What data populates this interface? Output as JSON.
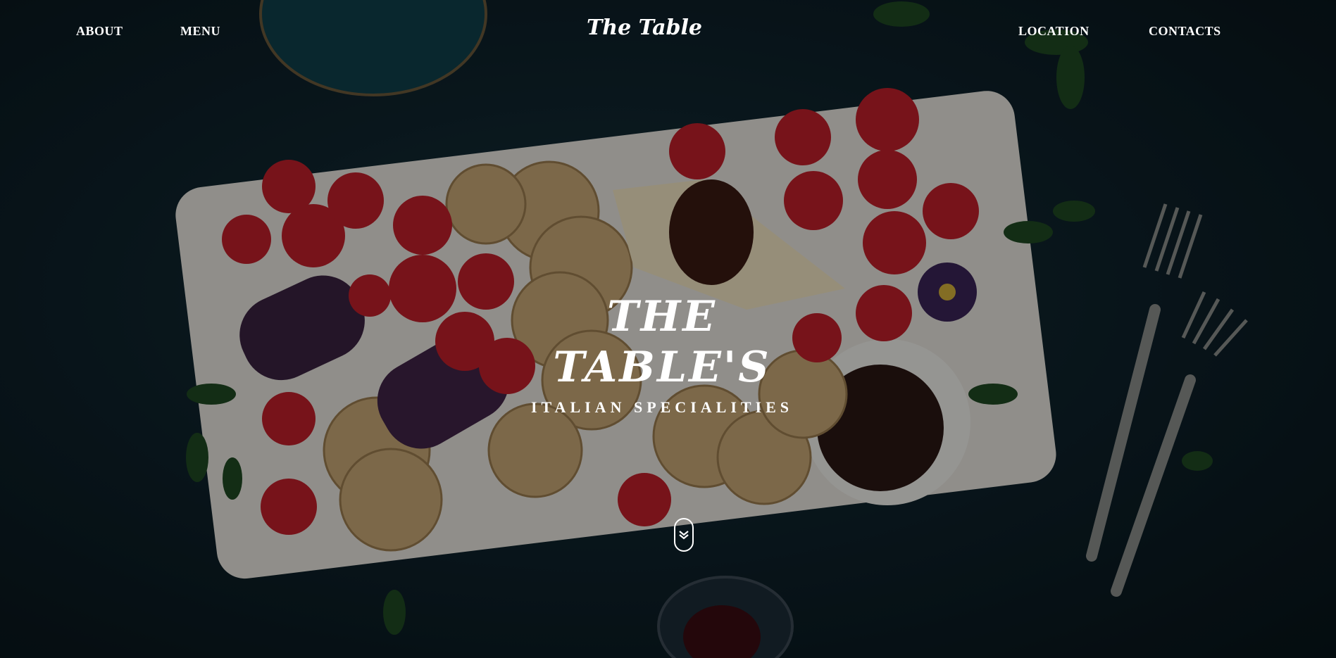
{
  "nav": {
    "about": "ABOUT",
    "menu": "MENU",
    "location": "LOCATION",
    "contacts": "CONTACTS"
  },
  "logo": "The Table",
  "hero": {
    "title": "THE TABLE'S",
    "subtitle": "ITALIAN SPECIALITIES"
  },
  "scroll_icon": "double-chevron-down-icon",
  "colors": {
    "background": "#0d2029",
    "text": "#ffffff",
    "board": "#e9e6df"
  }
}
